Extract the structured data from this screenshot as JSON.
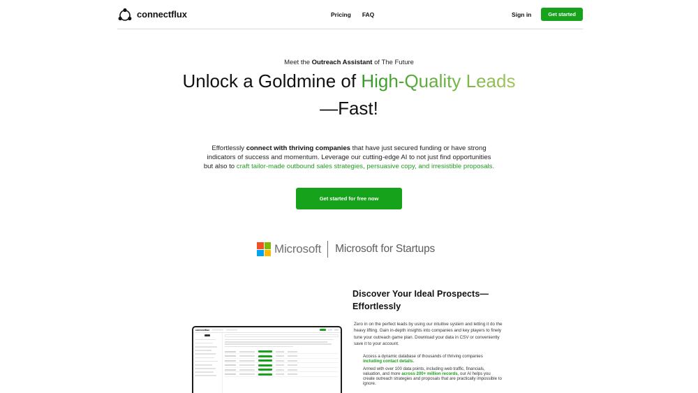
{
  "header": {
    "brand": "connectflux",
    "nav": [
      "Pricing",
      "FAQ"
    ],
    "sign_in": "Sign in",
    "get_started": "Get started"
  },
  "hero": {
    "eyebrow_pre": "Meet the ",
    "eyebrow_bold": "Outreach Assistant",
    "eyebrow_post": " of The Future",
    "headline_pre": "Unlock a Goldmine of ",
    "headline_highlight": "High-Quality Leads",
    "headline_post": " —Fast!",
    "intro_1": "Effortlessly ",
    "intro_bold": "connect with thriving companies",
    "intro_2": " that have just secured funding or have strong indicators of success and momentum. Leverage our cutting-edge AI to not just find opportunities but also to ",
    "intro_green": "craft tailor-made outbound sales strategies, persuasive copy, and irresistible proposals.",
    "cta": "Get started for free now"
  },
  "partners": {
    "microsoft": "Microsoft",
    "startups": "Microsoft for Startups"
  },
  "features": {
    "title": "Discover Your Ideal Prospects—Effortlessly",
    "description": "Zero in on the perfect leads by using our intuitive system and letting it do the heavy lifting. Gain in-depth insights into companies and key players to finely tune your outreach game plan. Download your data in CSV or conveniently save it to your account.",
    "item1_pre": "Access a dynamic database of thousands of thriving companies ",
    "item1_bold": "including contact details.",
    "item2_pre": "Armed with over 100 data points, including web traffic, financials, valuation, and more ",
    "item2_bold": "across 200+ million records",
    "item2_post": ", our AI helps you create outreach strategies and proposals that are practically impossible to ignore."
  },
  "app_preview": {
    "brand": "connectflux"
  },
  "colors": {
    "accent": "#16a21a",
    "gradient_start": "#2f9a24",
    "gradient_end": "#9fc55a",
    "ms_red": "#f25022",
    "ms_green": "#7fba00",
    "ms_blue": "#00a4ef",
    "ms_yellow": "#ffb900"
  }
}
